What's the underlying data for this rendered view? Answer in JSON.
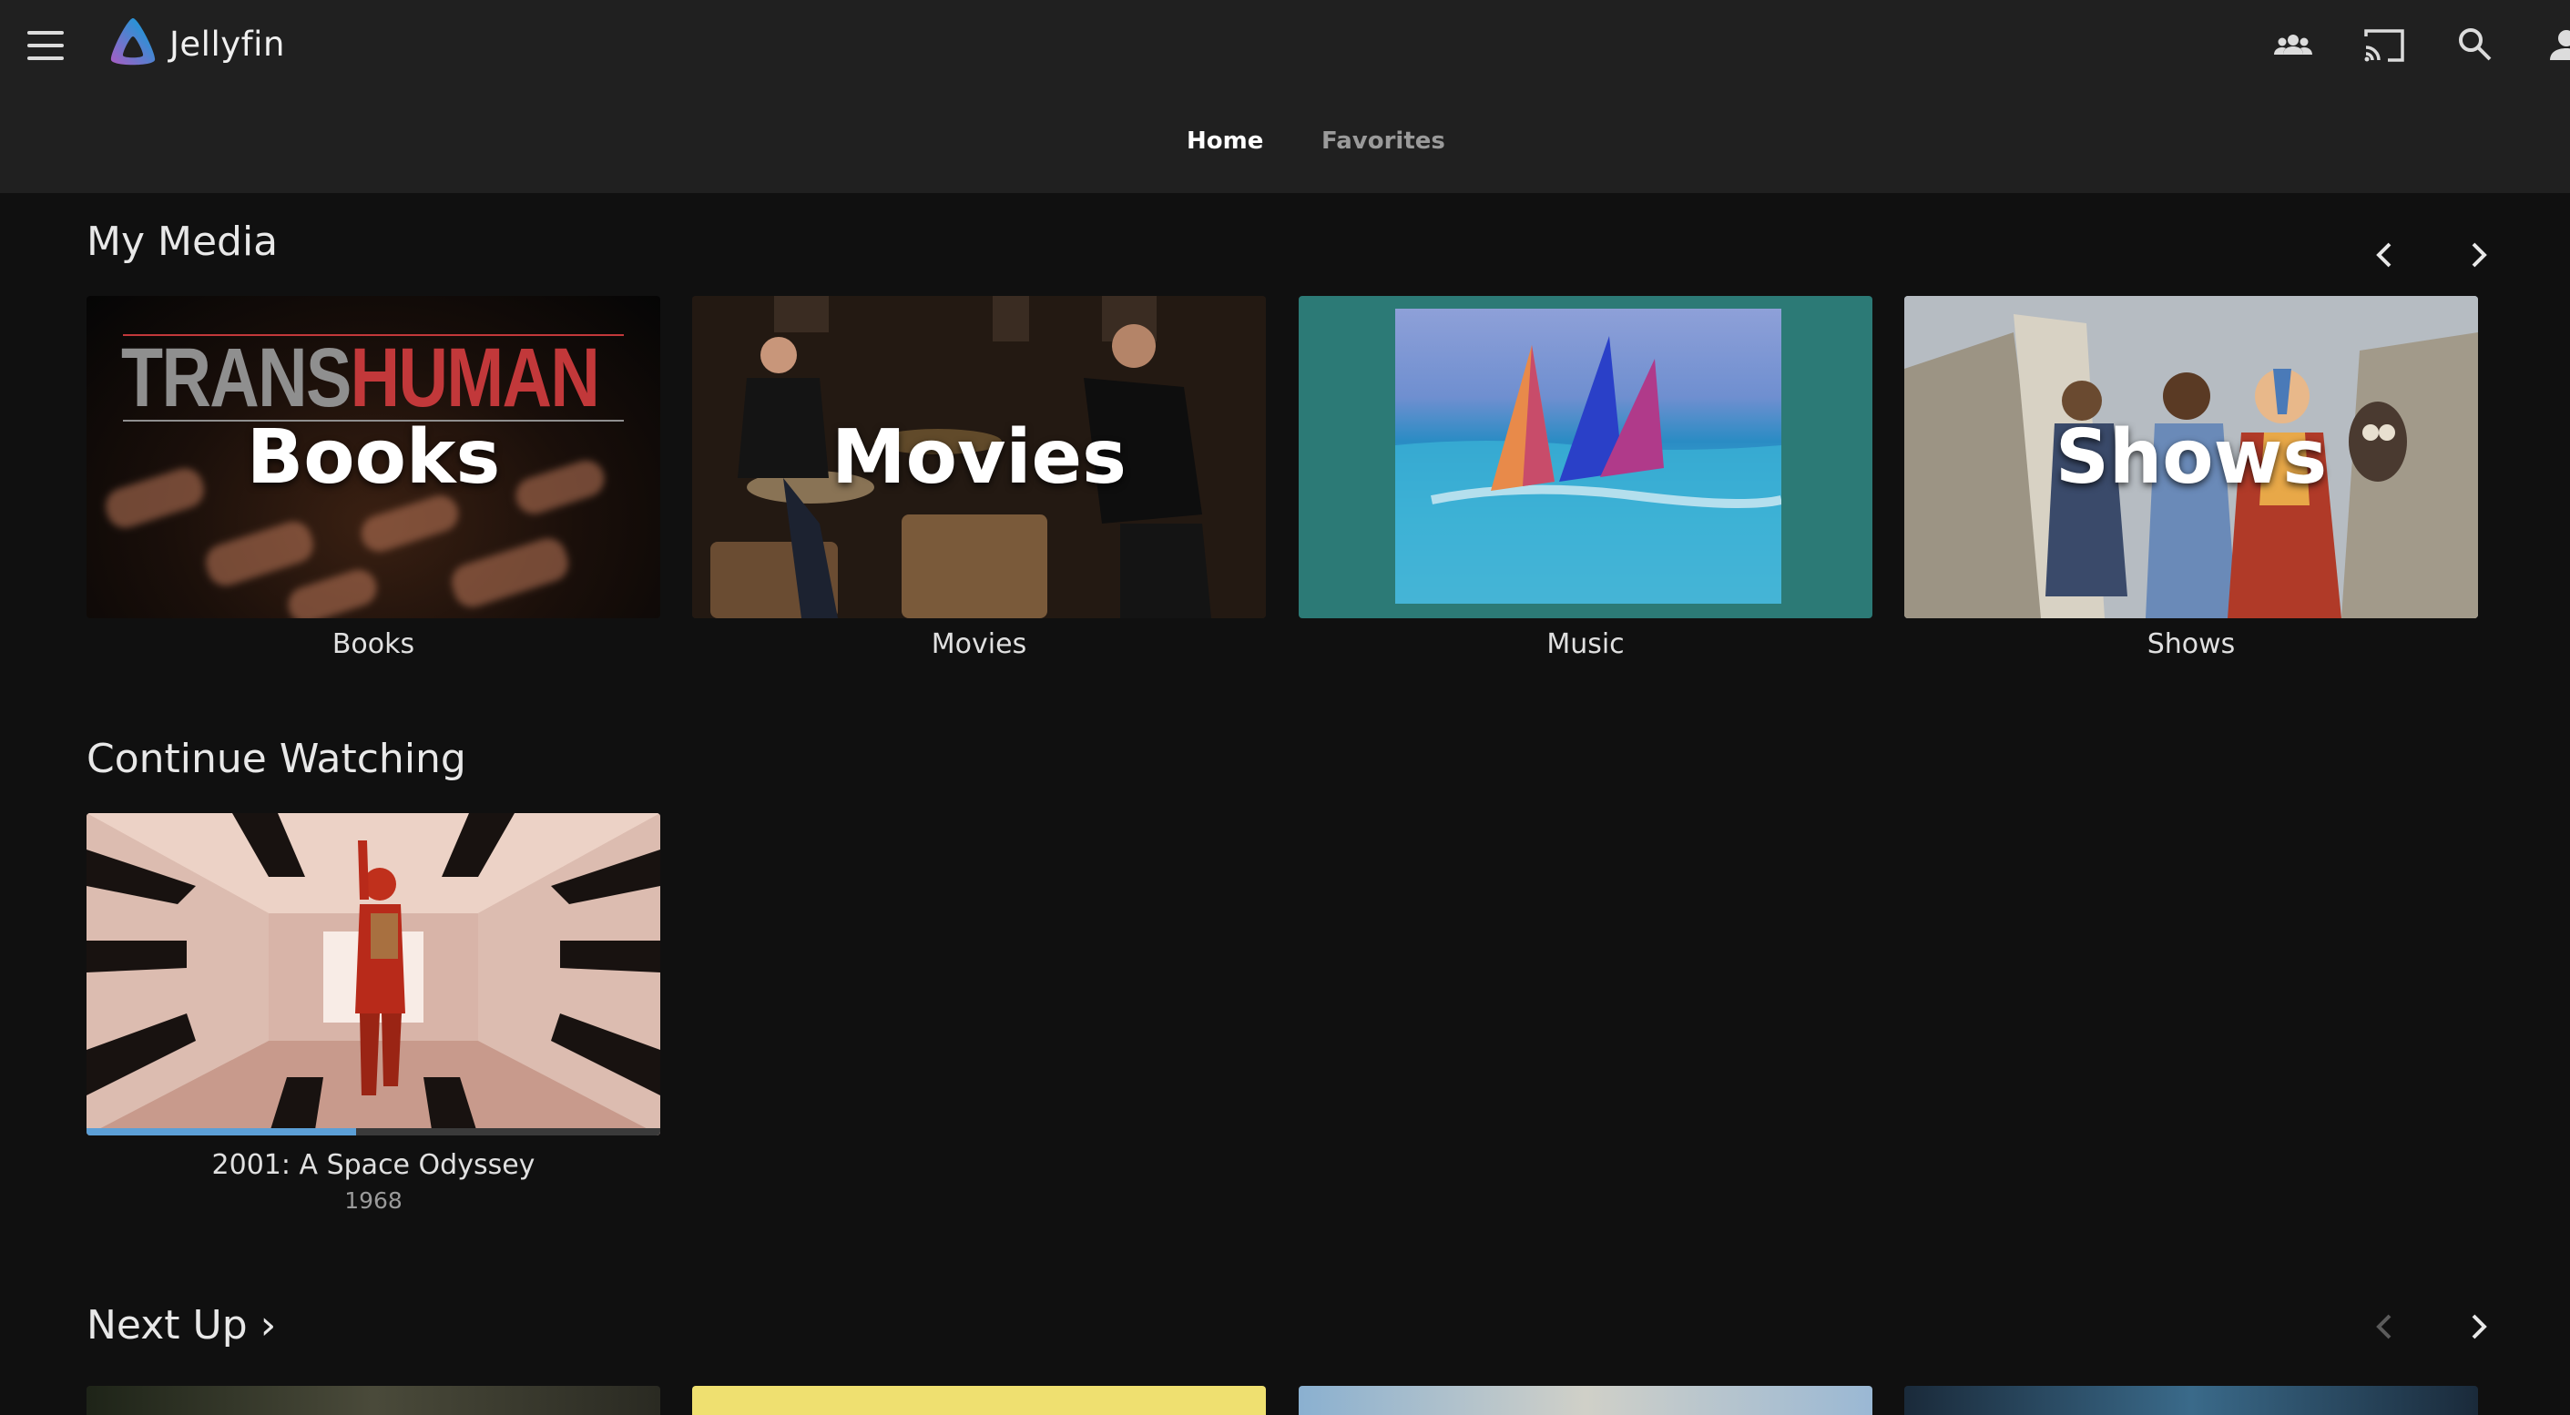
{
  "app": {
    "name": "Jellyfin"
  },
  "header": {
    "tabs": [
      {
        "label": "Home",
        "active": true
      },
      {
        "label": "Favorites",
        "active": false
      }
    ],
    "icons": [
      "menu-icon",
      "users-icon",
      "cast-icon",
      "search-icon",
      "user-icon"
    ]
  },
  "sections": {
    "my_media": {
      "title": "My Media",
      "items": [
        {
          "label": "Books",
          "overlay": "Books",
          "art_text": [
            "TRANS",
            "HUMAN"
          ]
        },
        {
          "label": "Movies",
          "overlay": "Movies"
        },
        {
          "label": "Music"
        },
        {
          "label": "Shows",
          "overlay": "Shows"
        }
      ]
    },
    "continue_watching": {
      "title": "Continue Watching",
      "items": [
        {
          "title": "2001: A Space Odyssey",
          "year": "1968",
          "progress": 0.47
        }
      ]
    },
    "next_up": {
      "title": "Next Up",
      "chevron": "›"
    }
  },
  "colors": {
    "accent": "#aa5cc3",
    "accent2": "#00a4dc",
    "progress": "#5c9fd6",
    "header_bg": "#202020",
    "page_bg": "#101010"
  }
}
